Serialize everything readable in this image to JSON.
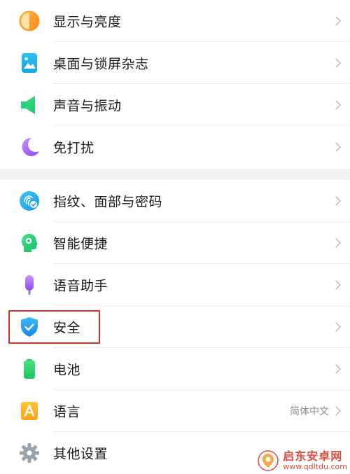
{
  "group1": [
    {
      "label": "显示与亮度",
      "icon": "brightness-icon"
    },
    {
      "label": "桌面与锁屏杂志",
      "icon": "wallpaper-icon"
    },
    {
      "label": "声音与振动",
      "icon": "speaker-icon"
    },
    {
      "label": "免打扰",
      "icon": "moon-icon"
    }
  ],
  "group2": [
    {
      "label": "指纹、面部与密码",
      "icon": "fingerprint-face-icon"
    },
    {
      "label": "智能便捷",
      "icon": "smart-head-icon"
    },
    {
      "label": "语音助手",
      "icon": "microphone-icon"
    },
    {
      "label": "安全",
      "icon": "shield-check-icon"
    },
    {
      "label": "电池",
      "icon": "battery-icon"
    },
    {
      "label": "语言",
      "icon": "language-a-icon",
      "value": "简体中文"
    },
    {
      "label": "其他设置",
      "icon": "gear-icon"
    }
  ],
  "watermark": {
    "title": "启东安卓网",
    "url": "www.qdltdu.com"
  },
  "colors": {
    "highlight": "#d9312b",
    "accent_blue": "#2aa8f0",
    "text": "#1a1a1a"
  }
}
